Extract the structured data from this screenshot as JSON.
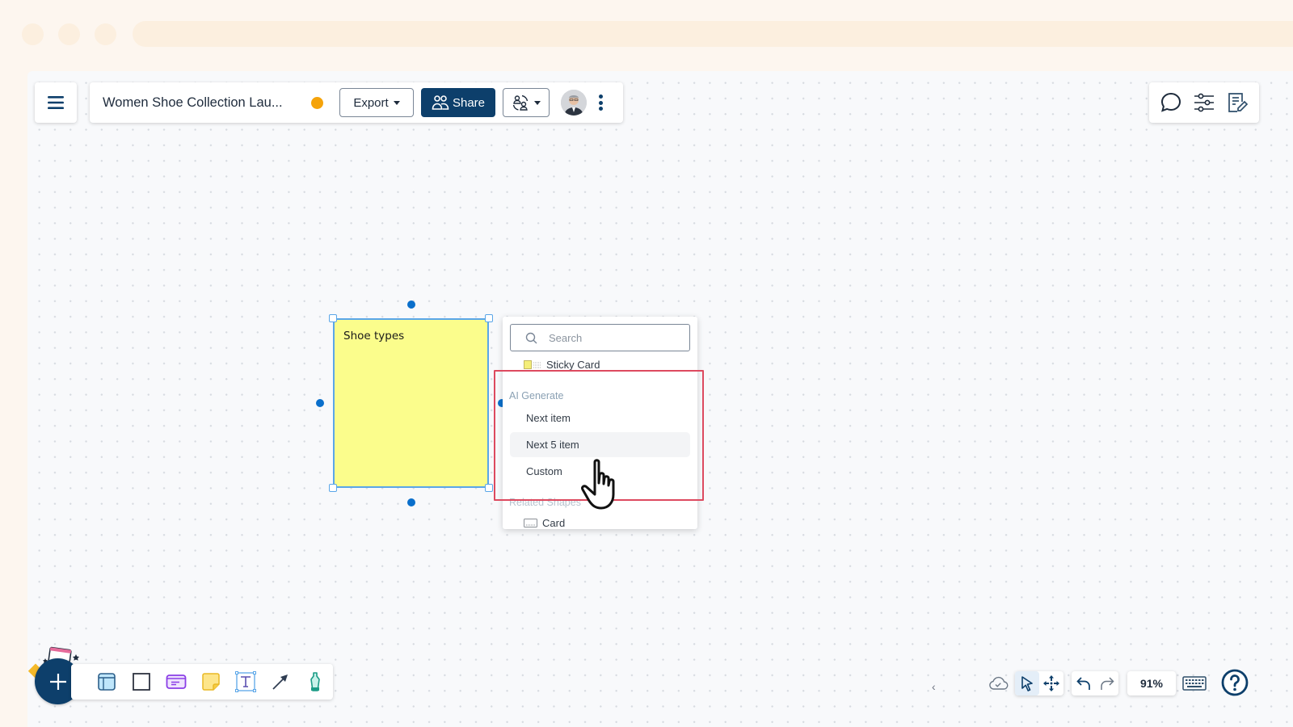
{
  "header": {
    "doc_title": "Women Shoe Collection Lau...",
    "status_color": "#f5a30a",
    "export_label": "Export",
    "share_label": "Share",
    "collab_icon": "people-switch-icon",
    "avatar_alt": "user-avatar"
  },
  "right_panel": {
    "icons": [
      "comment-icon",
      "settings-sliders-icon",
      "notes-edit-icon"
    ]
  },
  "canvas": {
    "sticky_note": {
      "text": "Shoe types",
      "fill_color": "#fbfd8c"
    }
  },
  "dropdown": {
    "search_placeholder": "Search",
    "shape_top": "Sticky Card",
    "ai_section_label": "AI Generate",
    "ai_items": [
      {
        "label": "Next item"
      },
      {
        "label": "Next 5 item"
      },
      {
        "label": "Custom"
      }
    ],
    "related_section_label": "Related Shapes",
    "related_items": [
      {
        "label": "Card"
      }
    ]
  },
  "bottom_toolbar": {
    "tools": [
      "add-button",
      "frame-tool",
      "rectangle-tool",
      "card-tool",
      "sticky-note-tool",
      "text-tool",
      "arrow-tool",
      "marker-tool"
    ]
  },
  "bottom_right": {
    "zoom_level": "91%",
    "collapse_glyph": "‹"
  },
  "colors": {
    "brand": "#0d3f6b",
    "highlight": "#dd4a5f",
    "selection": "#5aa6e8"
  }
}
